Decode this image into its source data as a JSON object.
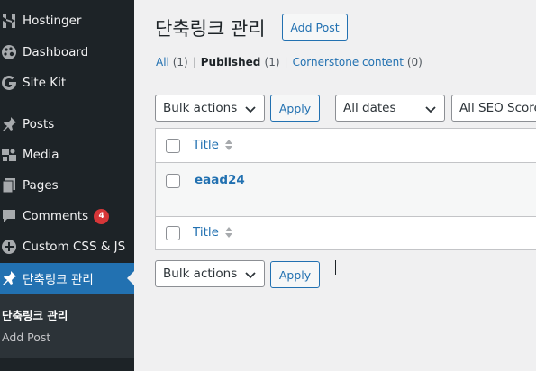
{
  "sidebar": {
    "items": [
      {
        "label": "Hostinger",
        "icon": "hostinger-icon"
      },
      {
        "label": "Dashboard",
        "icon": "palette-icon"
      },
      {
        "label": "Site Kit",
        "icon": "google-g-icon"
      },
      {
        "label": "Posts",
        "icon": "pin-icon"
      },
      {
        "label": "Media",
        "icon": "media-icon"
      },
      {
        "label": "Pages",
        "icon": "pages-icon"
      },
      {
        "label": "Comments",
        "icon": "comment-icon",
        "badge": "4"
      },
      {
        "label": "Custom CSS & JS",
        "icon": "plus-circle-icon"
      },
      {
        "label": "단축링크 관리",
        "icon": "pin-icon",
        "active": true
      }
    ],
    "submenu": [
      {
        "label": "단축링크 관리",
        "current": true
      },
      {
        "label": "Add Post"
      }
    ]
  },
  "header": {
    "title": "단축링크 관리",
    "add_button": "Add Post"
  },
  "filters": {
    "all_label": "All",
    "all_count": "(1)",
    "published_label": "Published",
    "published_count": "(1)",
    "cornerstone_label": "Cornerstone content",
    "cornerstone_count": "(0)"
  },
  "toolbar": {
    "bulk_actions": "Bulk actions",
    "apply": "Apply",
    "dates": "All dates",
    "seo_scores": "All SEO Scores"
  },
  "table": {
    "column_title": "Title",
    "rows": [
      {
        "title": "eaad24"
      }
    ]
  },
  "colors": {
    "sidebar_bg": "#1d2327",
    "accent": "#2271b1",
    "badge": "#d63638"
  }
}
